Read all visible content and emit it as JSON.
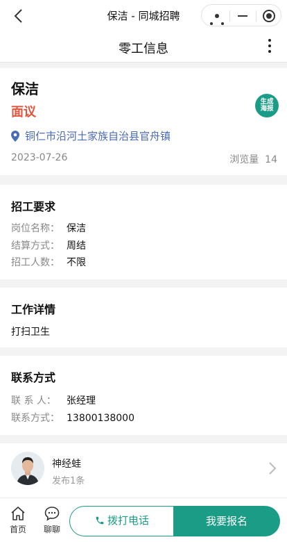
{
  "window": {
    "title": "保洁 - 同城招聘"
  },
  "header": {
    "title": "零工信息"
  },
  "job": {
    "title": "保洁",
    "salary": "面议",
    "poster_button": "生成海报",
    "location": "铜仁市沿河土家族自治县官舟镇",
    "date": "2023-07-26",
    "views_label": "浏览量",
    "views": "14"
  },
  "requirements": {
    "title": "招工要求",
    "rows": [
      {
        "label": "岗位名称：",
        "value": "保洁"
      },
      {
        "label": "结算方式：",
        "value": "周结"
      },
      {
        "label": "招工人数：",
        "value": "不限"
      }
    ]
  },
  "details": {
    "title": "工作详情",
    "text": "打扫卫生"
  },
  "contact": {
    "title": "联系方式",
    "rows": [
      {
        "label": "联 系 人：",
        "value": "张经理"
      },
      {
        "label": "联系方式：",
        "value": "13800138000"
      }
    ]
  },
  "publisher": {
    "name": "神经蛙",
    "count": "发布1条"
  },
  "bottom": {
    "home_label": "首页",
    "chat_label": "聊聊",
    "call_label": "拨打电话",
    "apply_label": "我要报名"
  },
  "colors": {
    "accent": "#1a9c86",
    "salary": "#e0553d",
    "link": "#4a6bb5"
  }
}
